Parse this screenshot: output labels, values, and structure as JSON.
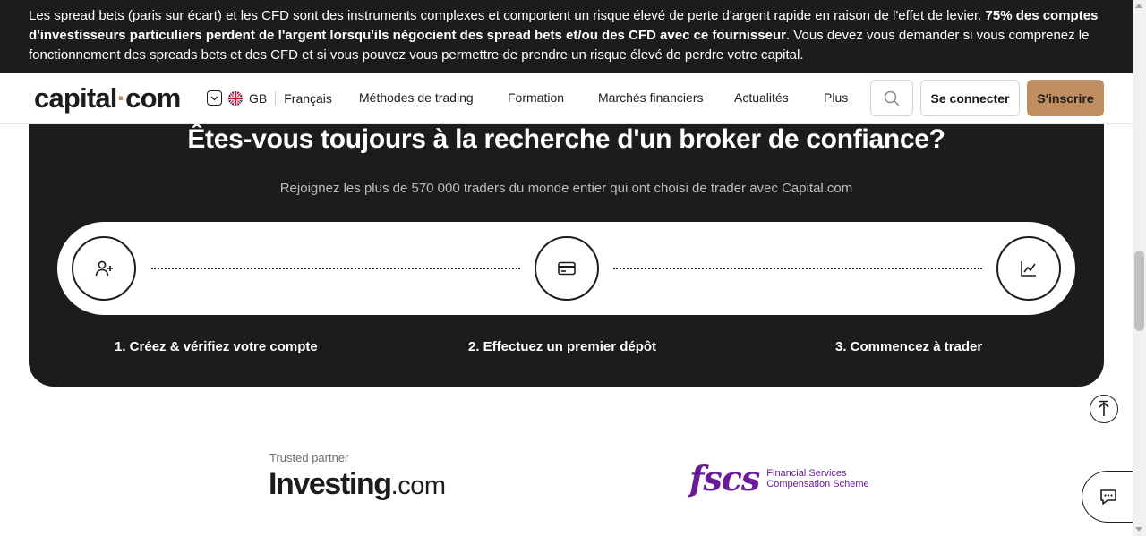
{
  "risk_warning": {
    "text_before": "Les spread bets (paris sur écart) et les CFD sont des instruments complexes et comportent un risque élevé de perte d'argent rapide en raison de l'effet de levier. ",
    "bold": "75% des comptes d'investisseurs particuliers perdent de l'argent lorsqu'ils négocient des spread bets et/ou des CFD avec ce fournisseur",
    "text_after": ". Vous devez vous demander si vous comprenez le fonctionnement des spreads bets et des CFD et si vous pouvez vous permettre de prendre un risque élevé de perdre votre capital."
  },
  "header": {
    "logo_left": "capital",
    "logo_dot": "·",
    "logo_right": "com",
    "region": "GB",
    "language": "Français",
    "nav": [
      "Méthodes de trading",
      "Formation",
      "Marchés financiers",
      "Actualités",
      "Plus"
    ],
    "login_label": "Se connecter",
    "signup_label": "S'inscrire",
    "icons": {
      "search": "search-icon",
      "chevron": "chevron-down-icon",
      "flag": "uk-flag-icon"
    }
  },
  "cta": {
    "title": "Êtes-vous toujours à la recherche d'un broker de confiance?",
    "subtitle": "Rejoignez les plus de 570 000 traders du monde entier qui ont choisi de trader avec Capital.com",
    "steps": [
      {
        "label": "1. Créez & vérifiez votre compte",
        "icon": "add-user-icon"
      },
      {
        "label": "2. Effectuez un premier dépôt",
        "icon": "credit-card-icon"
      },
      {
        "label": "3. Commencez à trader",
        "icon": "chart-line-icon"
      }
    ]
  },
  "partners": {
    "trusted_label": "Trusted partner",
    "investing_name": "Investing",
    "investing_suffix": ".com",
    "fscs_mark": "fscs",
    "fscs_line1": "Financial Services",
    "fscs_line2": "Compensation Scheme"
  },
  "colors": {
    "dark": "#1c1c1c",
    "accent": "#c08e5f",
    "signup_bg": "#c08e5f",
    "fscs_purple": "#6a1b9a"
  }
}
